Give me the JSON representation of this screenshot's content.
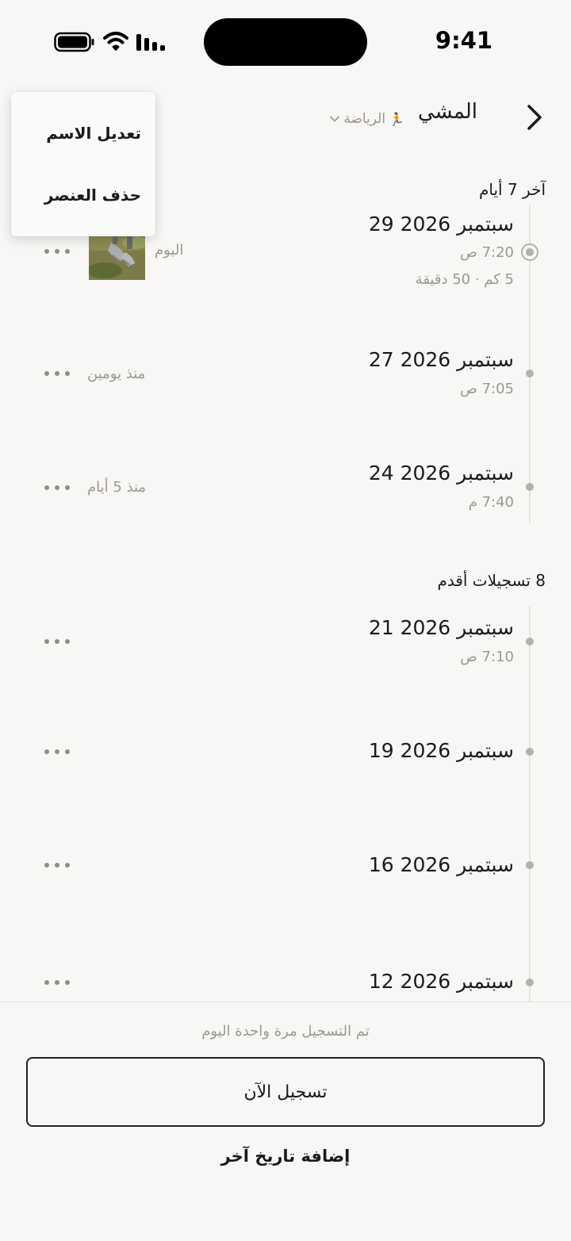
{
  "status_bar": {
    "time": "9:41"
  },
  "header": {
    "title": "المشي",
    "category": {
      "emoji": "🏃",
      "label": "الرياضة"
    }
  },
  "menu": {
    "items": [
      {
        "label": "تعديل الاسم"
      },
      {
        "label": "حذف العنصر"
      }
    ]
  },
  "recent": {
    "title": "آخر 7 أيام",
    "entries": [
      {
        "date": "29 سبتمبر 2026",
        "time": "7:20 ص",
        "meta": "5 كم · 50 دقيقة",
        "relative": "اليوم"
      },
      {
        "date": "27 سبتمبر 2026",
        "time": "7:05 ص",
        "relative": "منذ يومين"
      },
      {
        "date": "24 سبتمبر 2026",
        "time": "7:40 م",
        "relative": "منذ 5 أيام"
      }
    ]
  },
  "older": {
    "title": "8 تسجيلات أقدم",
    "entries": [
      {
        "date": "21 سبتمبر 2026",
        "time": "7:10 ص"
      },
      {
        "date": "19 سبتمبر 2026"
      },
      {
        "date": "16 سبتمبر 2026"
      },
      {
        "date": "12 سبتمبر 2026"
      }
    ]
  },
  "footer": {
    "note": "تم التسجيل مرة واحدة اليوم",
    "log_now": "تسجيل الآن",
    "add_date": "إضافة تاريخ آخر"
  },
  "colors": {
    "background": "#f8f7f5",
    "text": "#1a1a1a",
    "muted": "#9a9892",
    "timeline_dot": "#b3b1ac"
  }
}
